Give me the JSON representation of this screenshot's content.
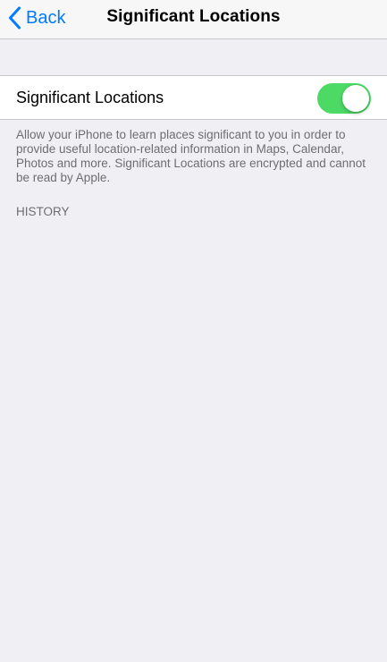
{
  "colors": {
    "accent": "#007aff",
    "toggle_on": "#4cd964",
    "background": "#efeff4",
    "secondary_text": "#6d6d72"
  },
  "navbar": {
    "back_icon": "chevron-left-icon",
    "back_label": "Back",
    "title": "Significant Locations"
  },
  "setting": {
    "label": "Significant Locations",
    "toggle_state": "on"
  },
  "footer": {
    "description": "Allow your iPhone to learn places significant to you in order to provide useful location-related information in Maps, Calendar, Photos and more. Significant Locations are encrypted and cannot be read by Apple."
  },
  "history": {
    "header": "HISTORY"
  }
}
